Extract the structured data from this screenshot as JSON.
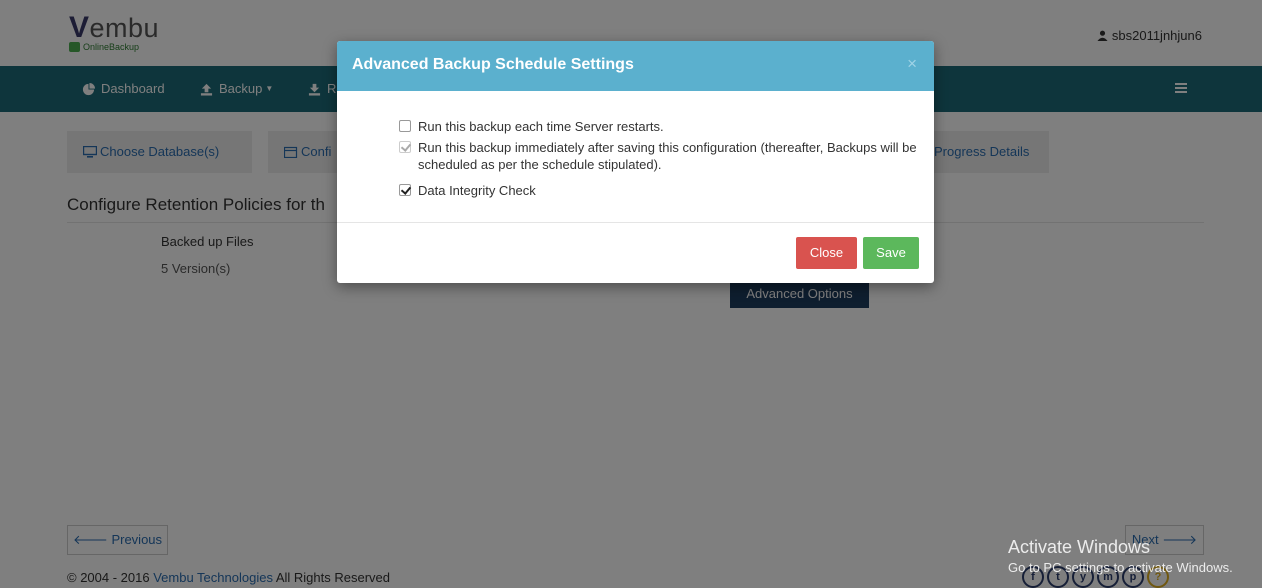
{
  "header": {
    "logo_text": "embu",
    "logo_letter": "V",
    "logo_sub": "OnlineBackup",
    "username": "sbs2011jnhjun6"
  },
  "nav": {
    "dashboard": "Dashboard",
    "backup": "Backup",
    "restore_partial": "R"
  },
  "steps": {
    "choose_database": "Choose Database(s)",
    "configure_partial": "Confi",
    "progress_details": "Progress Details"
  },
  "main": {
    "section_title_partial": "Configure Retention Policies for th",
    "col_label": "Backed up Files",
    "col_value": "5 Version(s)",
    "advanced_options": "Advanced Options"
  },
  "pagination": {
    "previous": "Previous",
    "next": "Next"
  },
  "footer": {
    "copyright_prefix": "© 2004 - 2016 ",
    "company": "Vembu Technologies",
    "copyright_suffix": " All Rights Reserved"
  },
  "social": [
    "f",
    "t",
    "y",
    "m",
    "p",
    "?"
  ],
  "watermark": {
    "line1": "Activate Windows",
    "line2": "Go to PC settings to activate Windows."
  },
  "modal": {
    "title": "Advanced Backup Schedule Settings",
    "close_symbol": "×",
    "options": [
      {
        "label": "Run this backup each time Server restarts.",
        "checked": false,
        "disabled": false
      },
      {
        "label": "Run this backup immediately after saving this configuration (thereafter, Backups will be scheduled as per the schedule stipulated).",
        "checked": true,
        "disabled": true
      },
      {
        "label": "Data Integrity Check",
        "checked": true,
        "disabled": false
      }
    ],
    "close_label": "Close",
    "save_label": "Save"
  },
  "colors": {
    "nav_bg": "#1d6b78",
    "modal_header": "#5bb0ce",
    "close_btn": "#d9534f",
    "save_btn": "#5cb85c",
    "advanced_btn": "#1d3c5e",
    "link": "#2a6db0"
  }
}
